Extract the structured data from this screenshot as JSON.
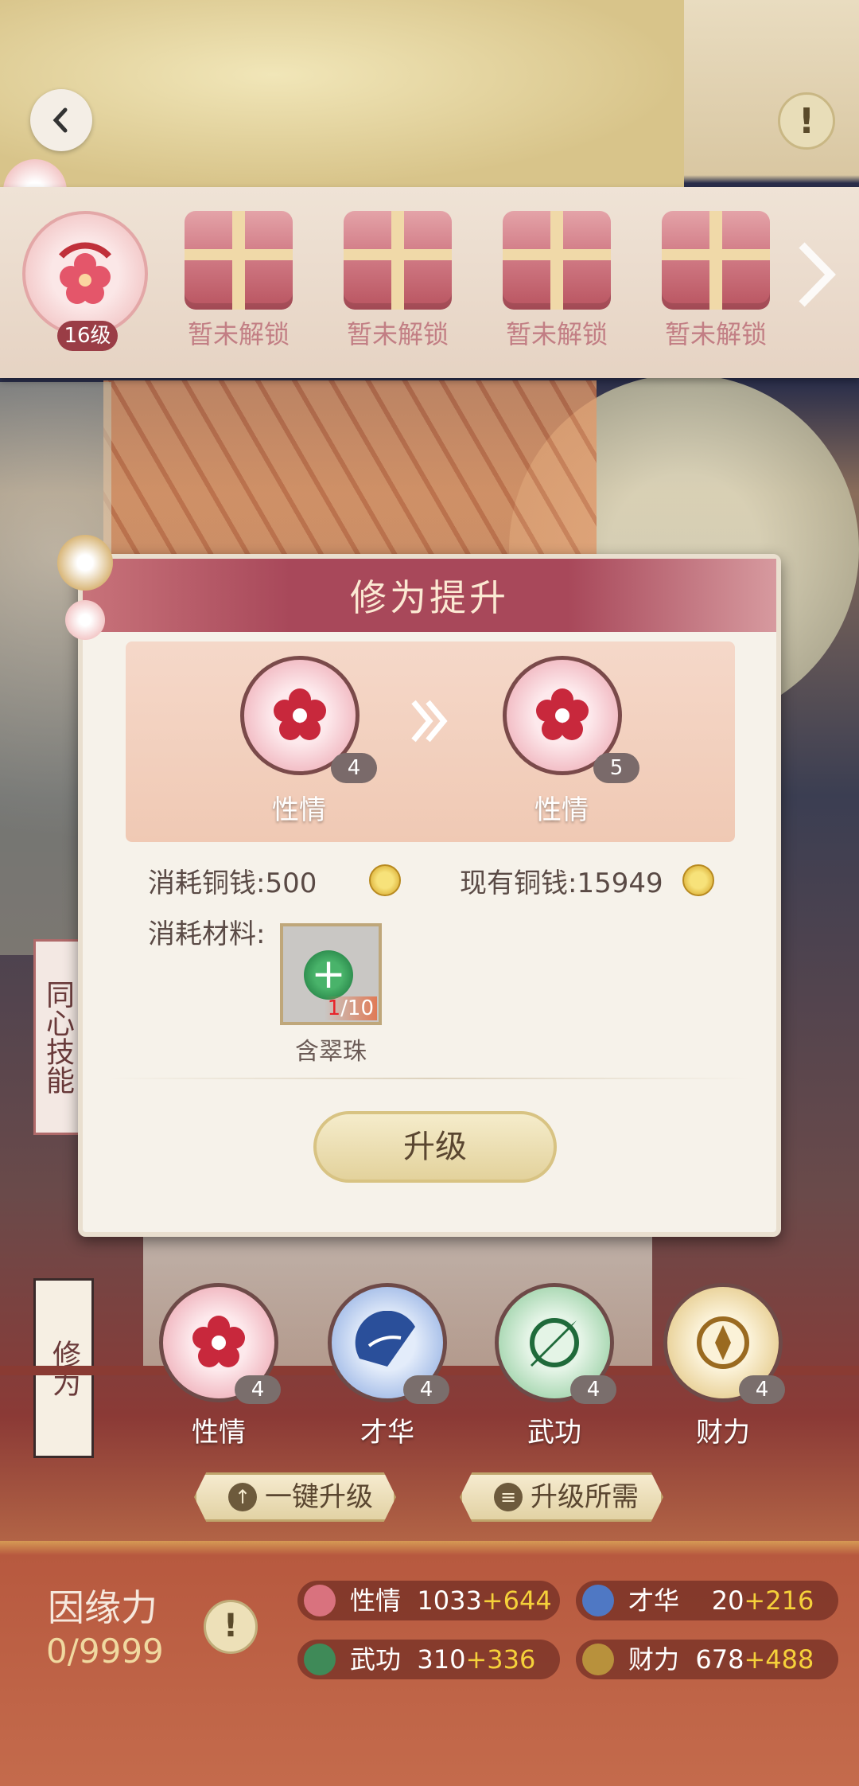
{
  "top": {
    "back_label": "‹",
    "info_label": "!"
  },
  "slots": {
    "active_level": "16级",
    "locked": [
      "暂未解锁",
      "暂未解锁",
      "暂未解锁",
      "暂未解锁"
    ]
  },
  "side_tabs": {
    "skill": "同心技能",
    "cultivation": "修为"
  },
  "modal": {
    "title": "修为提升",
    "from": {
      "label": "性情",
      "level": "4"
    },
    "to": {
      "label": "性情",
      "level": "5"
    },
    "cost_label": "消耗铜钱",
    "cost_value": "500",
    "have_label": "现有铜钱",
    "have_value": "15949",
    "material_label": "消耗材料",
    "material": {
      "plus": "+",
      "have": "1",
      "need": "/10",
      "name": "含翠珠"
    },
    "upgrade_button": "升级"
  },
  "attributes": [
    {
      "label": "性情",
      "level": "4"
    },
    {
      "label": "才华",
      "level": "4"
    },
    {
      "label": "武功",
      "level": "4"
    },
    {
      "label": "财力",
      "level": "4"
    }
  ],
  "actions": {
    "one_key": "一键升级",
    "requirements": "升级所需"
  },
  "fate": {
    "title": "因缘力",
    "value": "0/9999",
    "info": "!"
  },
  "stats": [
    {
      "label": "性情",
      "base": "1033",
      "bonus": "+644"
    },
    {
      "label": "才华",
      "base": "20",
      "bonus": "+216"
    },
    {
      "label": "武功",
      "base": "310",
      "bonus": "+336"
    },
    {
      "label": "财力",
      "base": "678",
      "bonus": "+488"
    }
  ],
  "colors": {
    "accent": "#a8485a",
    "gold": "#f5d13a",
    "panel": "#f6f2ea"
  }
}
